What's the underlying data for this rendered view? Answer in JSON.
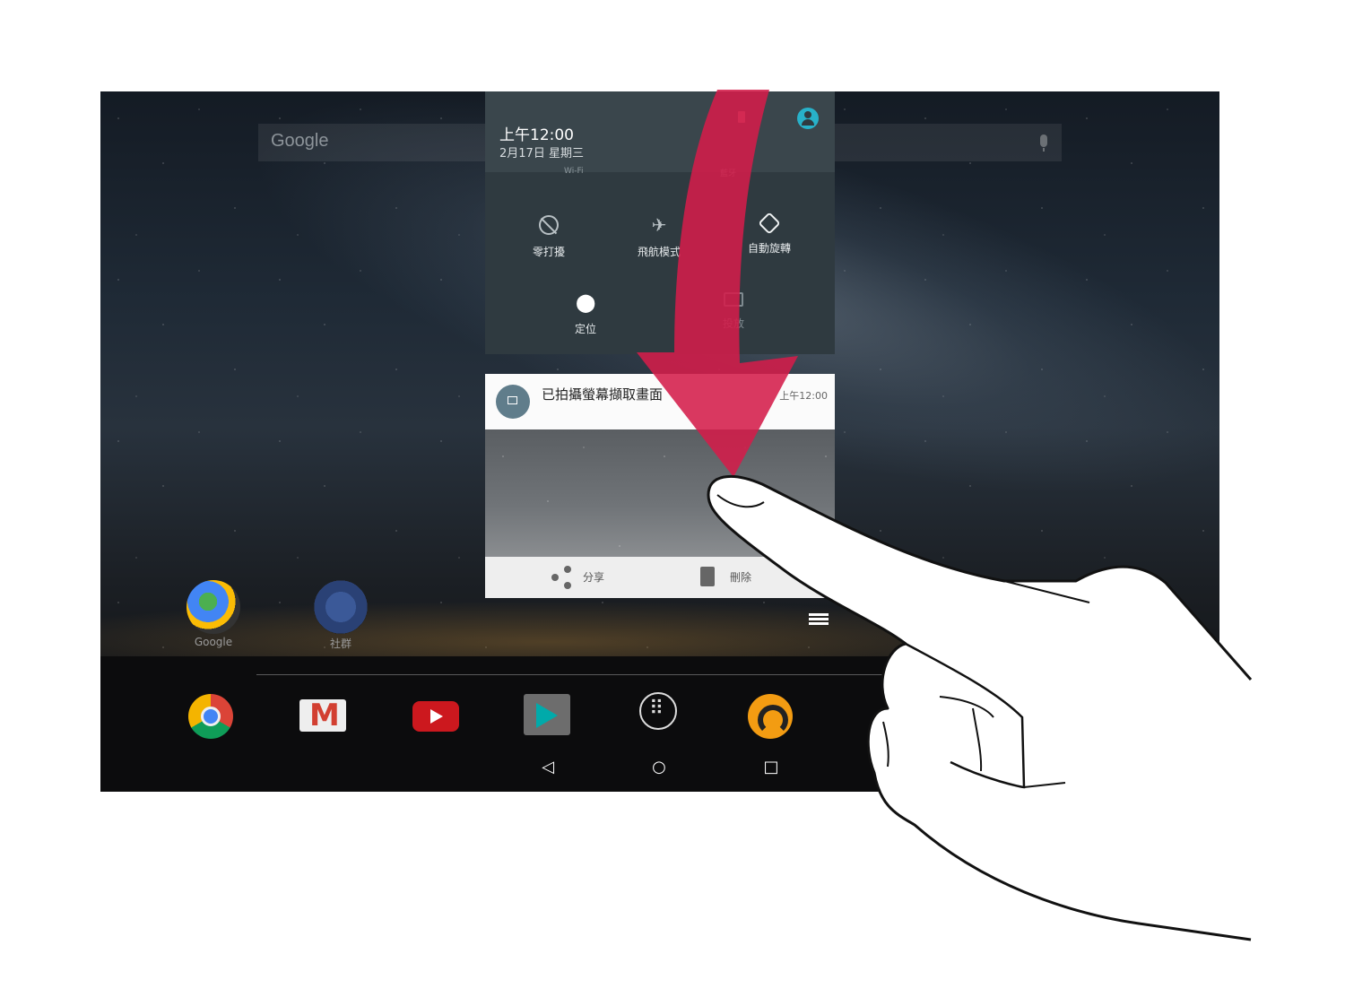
{
  "search": {
    "logo_text": "Google"
  },
  "status_panel": {
    "time": "上午12:00",
    "date": "2月17日 星期三",
    "wifi_label": "Wi-Fi",
    "bluetooth_label": "藍牙"
  },
  "quick_settings": [
    {
      "label": "零打擾",
      "icon": "do-not-disturb-icon"
    },
    {
      "label": "飛航模式",
      "icon": "airplane-icon"
    },
    {
      "label": "自動旋轉",
      "icon": "rotate-icon"
    },
    {
      "label": "定位",
      "icon": "location-pin-icon"
    },
    {
      "label": "投放",
      "icon": "cast-icon"
    }
  ],
  "notification": {
    "title": "已拍攝螢幕擷取畫面",
    "time": "上午12:00",
    "share_label": "分享",
    "delete_label": "刪除"
  },
  "home_apps": [
    {
      "label": "Google",
      "icon": "google-maps-folder-icon"
    },
    {
      "label": "社群",
      "icon": "facebook-folder-icon"
    }
  ],
  "dock": [
    "chrome-icon",
    "gmail-icon",
    "youtube-icon",
    "play-store-icon",
    "app-launcher-icon",
    "play-music-icon"
  ],
  "colors": {
    "gesture_arrow": "#d41c4a",
    "panel": "#2f3a40",
    "accent": "#28b1c9"
  }
}
